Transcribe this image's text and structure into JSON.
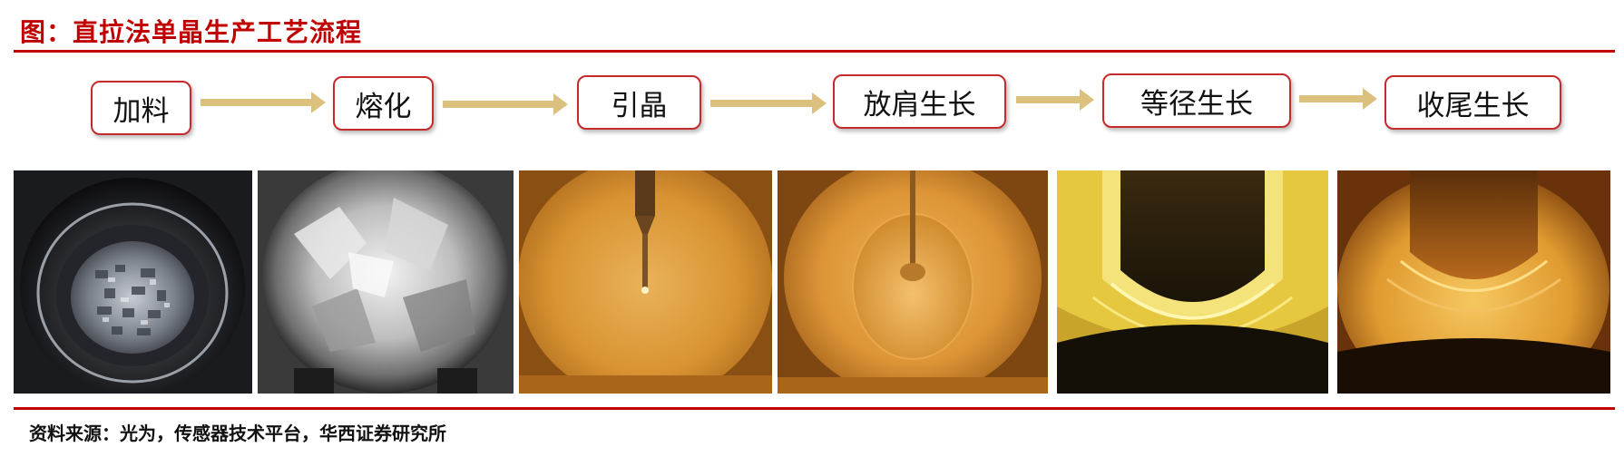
{
  "header": {
    "title": "图：直拉法单晶生产工艺流程"
  },
  "steps": [
    {
      "label": "加料"
    },
    {
      "label": "熔化"
    },
    {
      "label": "引晶"
    },
    {
      "label": "放肩生长"
    },
    {
      "label": "等径生长"
    },
    {
      "label": "收尾生长"
    }
  ],
  "colors": {
    "accent": "#c00000",
    "arrow": "#dcc07d",
    "box_border": "#c62a2a"
  },
  "footer": {
    "source": "资料来源：光为，传感器技术平台，华西证券研究所"
  }
}
